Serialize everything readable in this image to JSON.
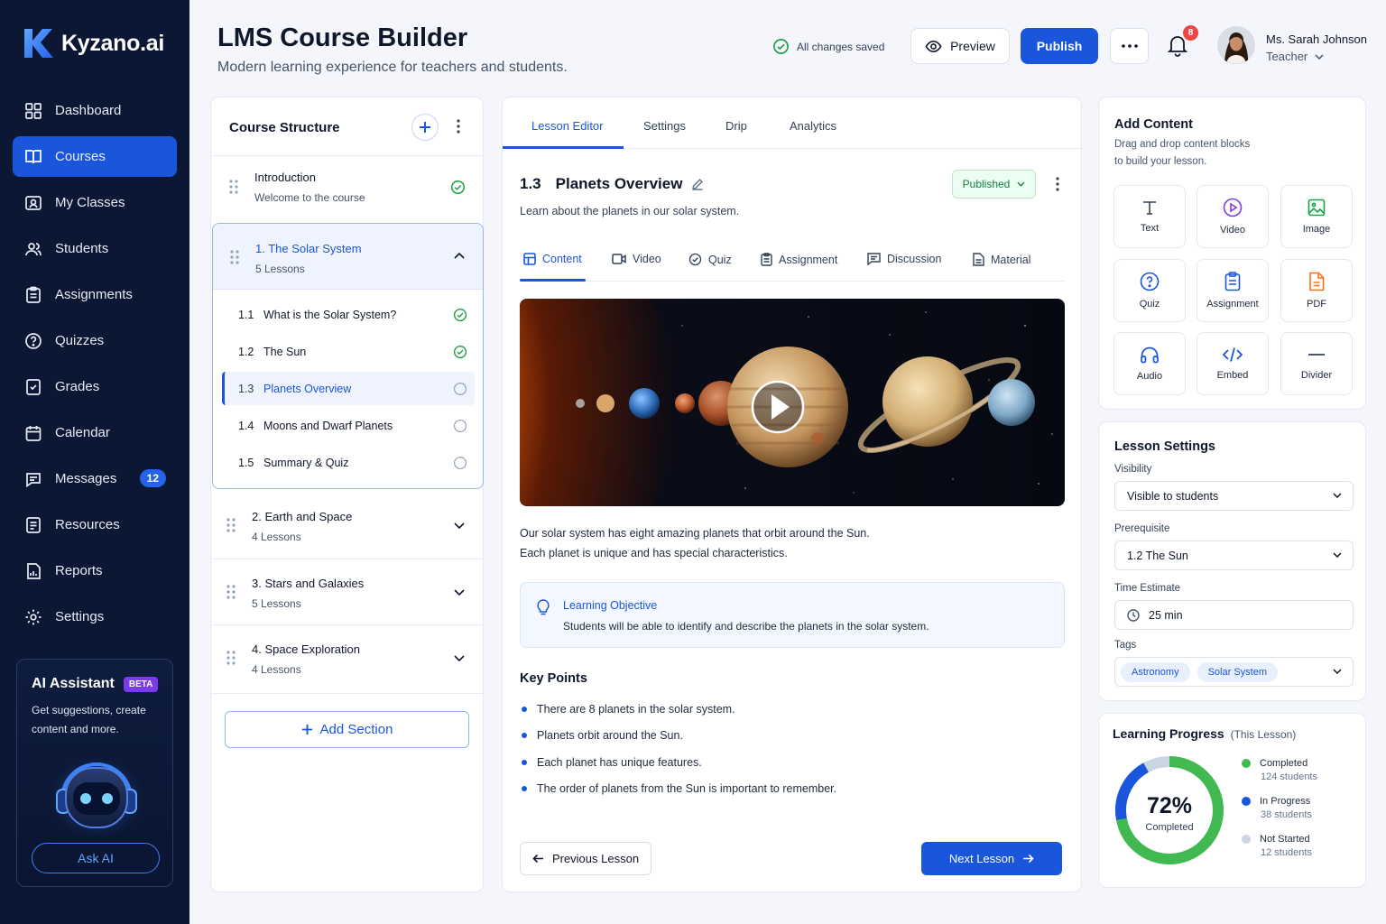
{
  "brand": {
    "name": "Kyzano.ai",
    "accent": "#1a56db",
    "sidebar_bg": "#0b1733"
  },
  "sidebar": {
    "items": [
      {
        "label": "Dashboard",
        "icon": "grid-icon"
      },
      {
        "label": "Courses",
        "icon": "book-icon",
        "active": true
      },
      {
        "label": "My Classes",
        "icon": "class-icon"
      },
      {
        "label": "Students",
        "icon": "users-icon"
      },
      {
        "label": "Assignments",
        "icon": "clipboard-icon"
      },
      {
        "label": "Quizzes",
        "icon": "help-circle-icon"
      },
      {
        "label": "Grades",
        "icon": "grades-icon"
      },
      {
        "label": "Calendar",
        "icon": "calendar-icon"
      },
      {
        "label": "Messages",
        "icon": "message-icon",
        "badge": "12"
      },
      {
        "label": "Resources",
        "icon": "file-icon"
      },
      {
        "label": "Reports",
        "icon": "report-icon"
      },
      {
        "label": "Settings",
        "icon": "gear-icon"
      }
    ],
    "ai": {
      "title": "AI Assistant",
      "badge": "BETA",
      "desc": "Get suggestions, create content and more.",
      "button": "Ask AI"
    }
  },
  "header": {
    "title": "LMS Course Builder",
    "subtitle": "Modern learning experience for teachers and students.",
    "saved": "All changes saved",
    "preview": "Preview",
    "publish": "Publish",
    "notifications": "8",
    "user_name": "Ms. Sarah Johnson",
    "user_role": "Teacher"
  },
  "structure": {
    "title": "Course Structure",
    "intro": {
      "title": "Introduction",
      "sub": "Welcome to the course"
    },
    "solar": {
      "title": "1. The Solar System",
      "sub": "5 Lessons"
    },
    "lessons": [
      {
        "num": "1.1",
        "title": "What is the Solar System?",
        "done": true
      },
      {
        "num": "1.2",
        "title": "The Sun",
        "done": true
      },
      {
        "num": "1.3",
        "title": "Planets Overview",
        "done": false,
        "active": true
      },
      {
        "num": "1.4",
        "title": "Moons and Dwarf Planets",
        "done": false
      },
      {
        "num": "1.5",
        "title": "Summary & Quiz",
        "done": false
      }
    ],
    "sections": [
      {
        "title": "2. Earth and Space",
        "sub": "4 Lessons"
      },
      {
        "title": "3. Stars and Galaxies",
        "sub": "5 Lessons"
      },
      {
        "title": "4. Space Exploration",
        "sub": "4 Lessons"
      }
    ],
    "add_section": "Add Section"
  },
  "editor": {
    "tabs": [
      "Lesson Editor",
      "Settings",
      "Drip",
      "Analytics"
    ],
    "lesson_num": "1.3",
    "lesson_title": "Planets Overview",
    "status": "Published",
    "description": "Learn about the planets in our solar system.",
    "content_tabs": [
      "Content",
      "Video",
      "Quiz",
      "Assignment",
      "Discussion",
      "Material"
    ],
    "para1": "Our solar system has eight amazing planets that orbit around the Sun.",
    "para2": "Each planet is unique and has special characteristics.",
    "objective_title": "Learning Objective",
    "objective_text": "Students will be able to identify and describe the planets in the solar system.",
    "key_points_title": "Key Points",
    "key_points": [
      "There are 8 planets in the solar system.",
      "Planets orbit around the Sun.",
      "Each planet has unique features.",
      "The order of planets from the Sun is important to remember."
    ],
    "prev": "Previous Lesson",
    "next": "Next Lesson"
  },
  "add_content": {
    "title": "Add Content",
    "desc1": "Drag and drop content blocks",
    "desc2": "to build your lesson.",
    "blocks": [
      "Text",
      "Video",
      "Image",
      "Quiz",
      "Assignment",
      "PDF",
      "Audio",
      "Embed",
      "Divider"
    ]
  },
  "lesson_settings": {
    "title": "Lesson Settings",
    "visibility_label": "Visibility",
    "visibility": "Visible to students",
    "prereq_label": "Prerequisite",
    "prereq": "1.2 The Sun",
    "time_label": "Time Estimate",
    "time": "25 min",
    "tags_label": "Tags",
    "tags": [
      "Astronomy",
      "Solar System"
    ]
  },
  "progress": {
    "title": "Learning Progress",
    "scope": "(This Lesson)",
    "percent": "72%",
    "percent_label": "Completed",
    "percent_value": 0.72,
    "legend": [
      {
        "label": "Completed",
        "sub": "124 students",
        "color": "#3fb950"
      },
      {
        "label": "In Progress",
        "sub": "38 students",
        "color": "#1a56db"
      },
      {
        "label": "Not Started",
        "sub": "12 students",
        "color": "#cbd5e1"
      }
    ]
  }
}
